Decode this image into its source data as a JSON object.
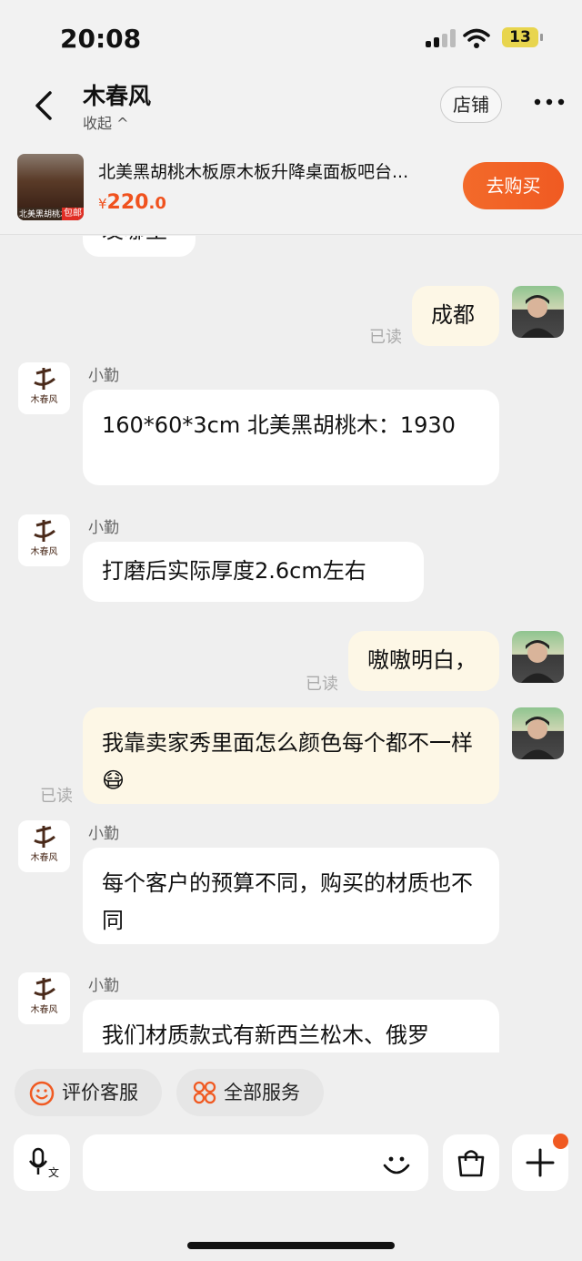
{
  "status_bar": {
    "time": "20:08",
    "battery": "13"
  },
  "header": {
    "title": "木春风",
    "collapse": "收起 ^",
    "shop": "店铺"
  },
  "product": {
    "title": "北美黑胡桃木板原木板升降桌面板吧台...",
    "currency": "¥",
    "price_int": "220",
    "price_dec": ".0",
    "buy": "去购买",
    "image_caption": "北美黑胡桃木板",
    "image_tag": "包邮"
  },
  "chat": {
    "partial_text": "发哪里",
    "read_label": "已读",
    "seller_name": "小勤",
    "seller_logo_text": "木春风",
    "messages": [
      {
        "text": "成都"
      },
      {
        "text": "160*60*3cm  北美黑胡桃木：1930"
      },
      {
        "text": "打磨后实际厚度2.6cm左右"
      },
      {
        "text": "嗷嗷明白，"
      },
      {
        "text": "我靠卖家秀里面怎么颜色每个都不一样",
        "emoji": "😷"
      },
      {
        "text": "每个客户的预算不同，购买的材质也不同"
      },
      {
        "text": "我们材质款式有新西兰松木、俄罗"
      }
    ]
  },
  "quick": {
    "rate": "评价客服",
    "all": "全部服务"
  },
  "input": {
    "placeholder": ""
  },
  "colors": {
    "accent": "#f05a22",
    "out_bubble": "#fdf7e6",
    "badge": "#f05a22"
  }
}
